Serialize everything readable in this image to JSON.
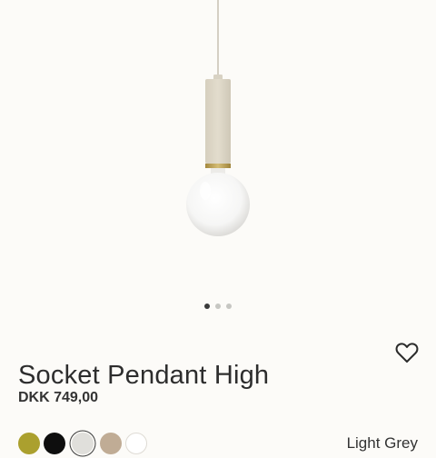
{
  "product": {
    "name": "Socket Pendant High",
    "price": "DKK 749,00",
    "selected_color_label": "Light Grey"
  },
  "gallery": {
    "image_icon": "pendant-lamp-image",
    "dots": [
      {
        "active": true
      },
      {
        "active": false
      },
      {
        "active": false
      }
    ]
  },
  "wishlist_icon": "heart-icon",
  "colors": {
    "background": "#fcfbf8",
    "text": "#2d2d2d",
    "socket": "#dcd6c6",
    "brass_ring": "#b89a4e"
  },
  "swatches": [
    {
      "name": "olive",
      "color": "#aba02e",
      "selected": false
    },
    {
      "name": "black",
      "color": "#0e0e0e",
      "selected": false
    },
    {
      "name": "light-grey",
      "color": "#e0dfdb",
      "selected": true
    },
    {
      "name": "cashmere",
      "color": "#c0ac95",
      "selected": false
    },
    {
      "name": "white",
      "color": "#ffffff",
      "selected": false
    }
  ]
}
